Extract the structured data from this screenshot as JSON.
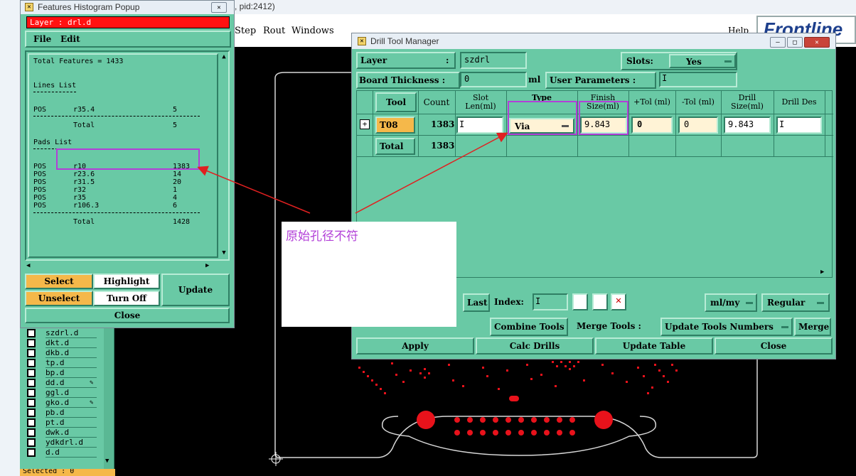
{
  "bg_window_title": "s, pid:2412)",
  "main_menu": [
    "Step",
    "Rout",
    "Windows"
  ],
  "help_label": "Help",
  "brand_text": "Frontline",
  "histogram": {
    "title": "Features Histogram Popup",
    "layer_label": "Layer :  drl.d",
    "menu": [
      "File",
      "Edit"
    ],
    "total_features": "Total Features = 1433",
    "lines_header": "Lines List",
    "lines": [
      {
        "pol": "POS",
        "sym": "r35.4",
        "count": "5"
      }
    ],
    "lines_total_label": "Total",
    "lines_total": "5",
    "pads_header": "Pads List",
    "pads": [
      {
        "pol": "POS",
        "sym": "r10",
        "count": "1383"
      },
      {
        "pol": "POS",
        "sym": "r23.6",
        "count": "14"
      },
      {
        "pol": "POS",
        "sym": "r31.5",
        "count": "20"
      },
      {
        "pol": "POS",
        "sym": "r32",
        "count": "1"
      },
      {
        "pol": "POS",
        "sym": "r35",
        "count": "4"
      },
      {
        "pol": "POS",
        "sym": "r106.3",
        "count": "6"
      }
    ],
    "pads_total_label": "Total",
    "pads_total": "1428",
    "buttons": {
      "select": "Select",
      "highlight": "Highlight",
      "update": "Update",
      "unselect": "Unselect",
      "turn_off": "Turn Off",
      "close": "Close"
    }
  },
  "layer_list": [
    "szdrl.d",
    "dkt.d",
    "dkb.d",
    "tp.d",
    "bp.d",
    "dd.d",
    "ggl.d",
    "gko.d",
    "pb.d",
    "pt.d",
    "dwk.d",
    "ydkdrl.d",
    "d.d"
  ],
  "selected_label": "Selected : 0",
  "drill": {
    "title": "Drill Tool Manager",
    "layer_label": "Layer",
    "layer_colon": ":",
    "layer_value": "szdrl",
    "slots_label": "Slots:",
    "slots_value": "Yes",
    "board_thickness_label": "Board Thickness :",
    "board_thickness_value": "0",
    "board_thickness_unit": "ml",
    "user_params_label": "User Parameters :",
    "columns": [
      "Tool",
      "Count",
      "Slot Len(ml)",
      "Type",
      "Finish Size(ml)",
      "+Tol (ml)",
      "-Tol (ml)",
      "Drill Size(ml)",
      "Drill Des"
    ],
    "row": {
      "tool": "T08",
      "count": "1383",
      "type": "Via",
      "finish": "9.843",
      "plus_tol": "0",
      "minus_tol": "0",
      "drill_size": "9.843"
    },
    "total_label": "Total",
    "total_count": "1383",
    "last_label": "Last",
    "index_label": "Index:",
    "units_value": "ml/my",
    "mode_value": "Regular",
    "combine_tools": "Combine Tools",
    "merge_tools_label": "Merge Tools :",
    "update_tools_numbers": "Update Tools Numbers",
    "merge": "Merge",
    "apply": "Apply",
    "calc_drills": "Calc Drills",
    "update_table": "Update Table",
    "close": "Close"
  },
  "annotation_text": "原始孔径不符",
  "colors": {
    "teal": "#69c9a5",
    "red": "#e8121b",
    "highlight": "#b23fd8",
    "orange": "#f5b84a",
    "arrow": "#e02020"
  }
}
